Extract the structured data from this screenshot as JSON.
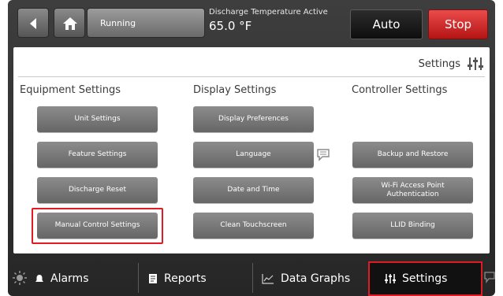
{
  "header": {
    "status": "Running",
    "discharge_label": "Discharge Temperature Active",
    "discharge_value": "65.0 °F",
    "auto_label": "Auto",
    "stop_label": "Stop"
  },
  "page": {
    "title": "Settings"
  },
  "columns": [
    {
      "title": "Equipment Settings",
      "buttons": [
        "Unit Settings",
        "Feature Settings",
        "Discharge Reset",
        "Manual Control Settings"
      ]
    },
    {
      "title": "Display Settings",
      "buttons": [
        "Display Preferences",
        "Language",
        "Date and Time",
        "Clean Touchscreen"
      ]
    },
    {
      "title": "Controller Settings",
      "buttons": [
        "Backup and Restore",
        "Wi-Fi Access Point Authentication",
        "LLID Binding"
      ]
    }
  ],
  "tabs": {
    "alarms": "Alarms",
    "reports": "Reports",
    "data_graphs": "Data Graphs",
    "settings": "Settings"
  },
  "colors": {
    "stop": "#d42020",
    "highlight": "#e01b24",
    "button_gray": "#7a7a7a"
  }
}
